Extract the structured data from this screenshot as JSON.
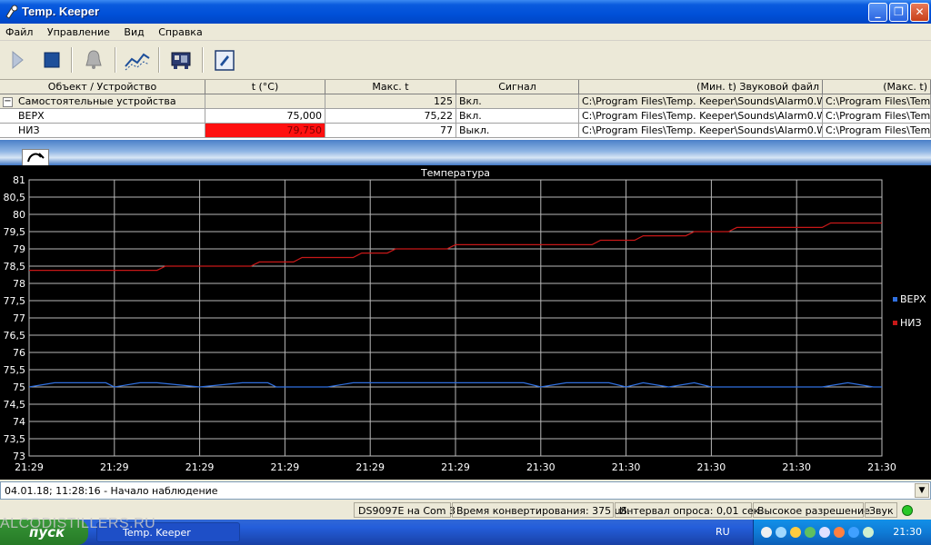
{
  "window": {
    "title": "Temp. Keeper"
  },
  "menu": [
    "Файл",
    "Управление",
    "Вид",
    "Справка"
  ],
  "toolbar": {
    "icons": [
      "play-icon",
      "stop-icon",
      "bell-icon",
      "chart-icon",
      "device-icon",
      "settings-icon"
    ]
  },
  "table": {
    "headers": [
      "Объект / Устройство",
      "t (°C)",
      "Макс. t",
      "Сигнал",
      "(Мин. t) Звуковой файл",
      "(Макс. t)"
    ],
    "group": {
      "expander": "−",
      "name": "Самостоятельные устройства",
      "temp": "",
      "max": "125",
      "signal": "Вкл.",
      "min_file": "C:\\Program Files\\Temp. Keeper\\Sounds\\Alarm0.Wav",
      "max_file": "C:\\Program Files\\Temp."
    },
    "rows": [
      {
        "name": "ВЕРХ",
        "temp": "75,000",
        "max": "75,22",
        "signal": "Вкл.",
        "min_file": "C:\\Program Files\\Temp. Keeper\\Sounds\\Alarm0.Wav",
        "max_file": "C:\\Program Files\\Temp."
      },
      {
        "name": "НИЗ",
        "temp": "79,750",
        "max": "77",
        "signal": "Выкл.",
        "min_file": "C:\\Program Files\\Temp. Keeper\\Sounds\\Alarm0.Wav",
        "max_file": "C:\\Program Files\\Temp."
      }
    ],
    "alarm_color": "#ff1010"
  },
  "chart_data": {
    "type": "line",
    "title": "Температура",
    "ylim": [
      73,
      81
    ],
    "yticks": [
      "73",
      "73,5",
      "74",
      "74,5",
      "75",
      "75,5",
      "76",
      "76,5",
      "77",
      "77,5",
      "78",
      "78,5",
      "79",
      "79,5",
      "80",
      "80,5",
      "81"
    ],
    "xticks": [
      "21:29",
      "21:29",
      "21:29",
      "21:29",
      "21:29",
      "21:29",
      "21:30",
      "21:30",
      "21:30",
      "21:30",
      "21:30"
    ],
    "grid": true,
    "background": "#000000",
    "legend": {
      "position": "right"
    },
    "series": [
      {
        "name": "ВЕРХ",
        "color": "#3070e0",
        "x": [
          0,
          0.3,
          0.5,
          0.9,
          1.0,
          1.3,
          1.5,
          2.0,
          2.5,
          2.8,
          2.9,
          3.2,
          3.5,
          3.8,
          4.0,
          4.5,
          5.0,
          5.5,
          5.8,
          6.0,
          6.3,
          6.5,
          6.8,
          7.0,
          7.2,
          7.5,
          7.8,
          8.0,
          9.0,
          9.3,
          9.6,
          9.9,
          10.0
        ],
        "values": [
          75,
          75.12,
          75.12,
          75.12,
          75,
          75.12,
          75.12,
          75,
          75.12,
          75.12,
          75,
          75,
          75,
          75.12,
          75.12,
          75.12,
          75.12,
          75.12,
          75.12,
          75,
          75.12,
          75.12,
          75.12,
          75,
          75.12,
          75,
          75.12,
          75,
          75,
          75,
          75.12,
          75,
          75
        ]
      },
      {
        "name": "НИЗ",
        "color": "#c81818",
        "x": [
          0,
          1.5,
          1.6,
          2.6,
          2.7,
          3.1,
          3.2,
          3.8,
          3.9,
          4.2,
          4.3,
          4.9,
          5.0,
          5.5,
          5.6,
          6.6,
          6.7,
          7.1,
          7.2,
          7.7,
          7.8,
          8.2,
          8.3,
          8.8,
          8.9,
          9.3,
          9.4,
          10.0
        ],
        "values": [
          78.38,
          78.38,
          78.5,
          78.5,
          78.62,
          78.62,
          78.75,
          78.75,
          78.88,
          78.88,
          79.0,
          79.0,
          79.12,
          79.12,
          79.12,
          79.12,
          79.25,
          79.25,
          79.38,
          79.38,
          79.5,
          79.5,
          79.62,
          79.62,
          79.62,
          79.62,
          79.75,
          79.75
        ]
      }
    ]
  },
  "log": {
    "line": "04.01.18; 11:28:16 - Начало наблюдение"
  },
  "status": {
    "device": "DS9097E на Com 3",
    "convert": "Время конвертирования: 375 uS.",
    "interval": "Интервал опроса: 0,01 сек.",
    "resolution": "Высокое разрешение",
    "sound": "Звук"
  },
  "taskbar": {
    "start": "пуск",
    "task": "Temp. Keeper",
    "lang": "RU",
    "clock": "21:30",
    "watermark": "ALCODISTILLERS.RU"
  }
}
